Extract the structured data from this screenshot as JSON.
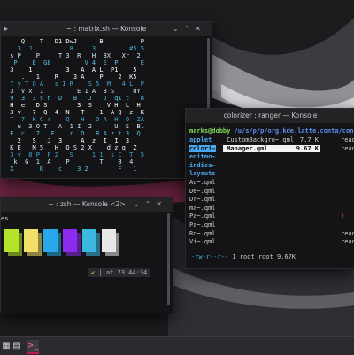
{
  "desktop": {
    "accent_color": "#c2185b"
  },
  "matrix_window": {
    "title": "~ : matrix.sh — Konsole",
    "lines": [
      "    Q    T   D1 DwJ      B          P  ",
      "   3  J          8     3         #5 5",
      " s P    P     T 3  R   H  3X   Xr  2",
      "  P    E  G8         V 4  E  P      E",
      " 3    1         3   A  A L  P1    5  ",
      "    .   1    R    3 A    P    2  K5  ",
      " 7 y T O A   s I R    S 5  M   4 L  P",
      " 3  V x  1         E 1 A  3 S     UY",
      " 9  3  3 s n  D   B   J   J  q1 t   8",
      " H  e   D S        3  S    V H  L  H",
      " 3 v   7  Q  4  N   T    1  A Q  z  K",
      " T  7  K C r    Q   H   O A  H  O  ZA",
      "   u  3 O T   A  1 I  2      U  S  Bl",
      " E  c   7   F    r  D   R A z t 3  Q",
      "   2   S   J  3     A  z  I  I  3   ",
      " K E   M 5   H  Q S 2 X    d z q  Z ",
      " 3 y  8 P  F Z   S     1 1  s C  T  5",
      "  k  G  1  A    P        T    B  4  ",
      " X       R    c    3 2        F   1 "
    ]
  },
  "zsh_window": {
    "title": "~ : zsh — Konsole <2>",
    "left_label": "es",
    "prompt_check": "✔",
    "prompt_time": "at 23:44:34",
    "swatches": [
      "#b4e32a",
      "#f0e06a",
      "#28a8e8",
      "#8c2cf0",
      "#3ab8e0",
      "#e8e8e8"
    ]
  },
  "ranger_window": {
    "title": "colorizer : ranger — Konsole",
    "path_user": "marks@dobby",
    "path_rest": "/u/s/p/p/org.kde.latte.conta/cont",
    "left_column": [
      "applet",
      "colori~",
      "editmo~",
      "indica~",
      "layouts",
      "Au~.qml",
      "De~.qml",
      "Dr~.qml",
      "ma~.qml",
      "Pa~.qml",
      "Pa~.qml",
      "Ro~.qml",
      "Vi~.qml"
    ],
    "middle_rows": [
      {
        "name": "CustomBackgro~.qml",
        "size": "7.7 K",
        "selected": false
      },
      {
        "name": "Manager.qml",
        "size": "9.67 K",
        "selected": true
      }
    ],
    "right_column": [
      "read",
      "read",
      "",
      "",
      "",
      "",
      "",
      "",
      "",
      "}",
      "",
      "read",
      "read"
    ],
    "status_perms": "-rw-r--r--",
    "status_rest": "1 root root 9.67K"
  },
  "taskbar": {
    "icons": [
      "apps-icon",
      "files-icon",
      "terminal-icon"
    ]
  }
}
